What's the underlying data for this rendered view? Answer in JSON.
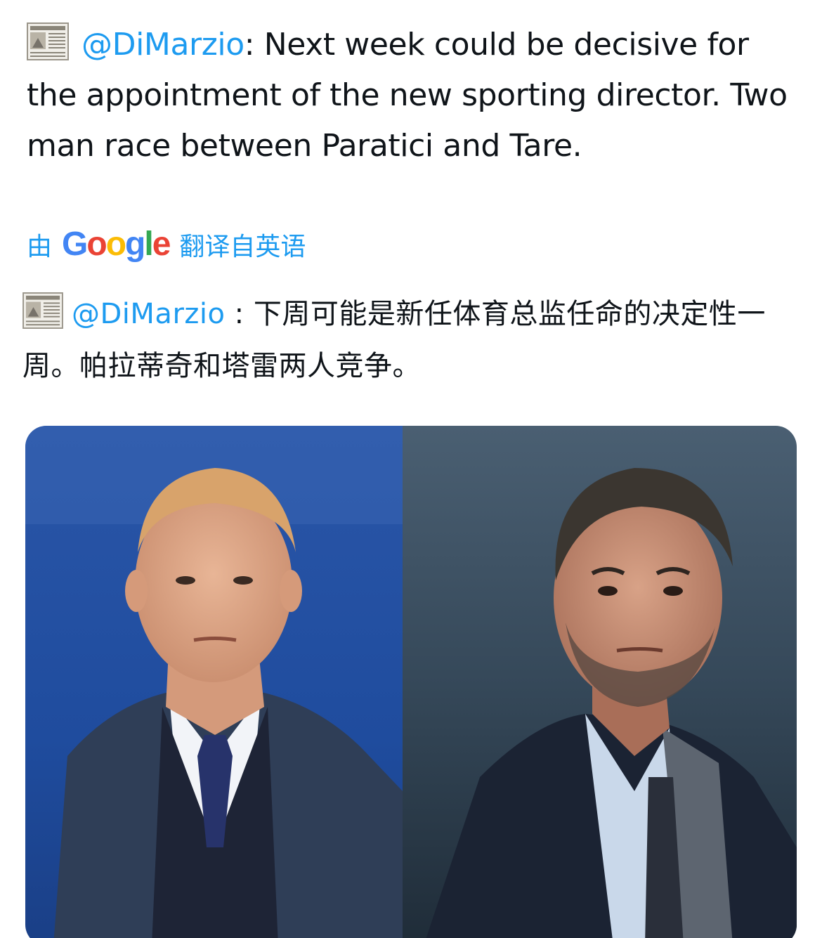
{
  "tweet": {
    "source_icon": "newspaper-icon",
    "mention": "@DiMarzio",
    "text": ": Next week could be decisive for the appointment of the new sporting director. Two man race between Paratici and Tare."
  },
  "translation_label": {
    "prefix": "由",
    "brand_letters": [
      "G",
      "o",
      "o",
      "g",
      "l",
      "e"
    ],
    "brand_colors": [
      "#4285f4",
      "#ea4335",
      "#fbbc05",
      "#4285f4",
      "#34a853",
      "#ea4335"
    ],
    "suffix": "翻译自英语"
  },
  "translation": {
    "source_icon": "newspaper-icon",
    "mention": "@DiMarzio",
    "text": " : 下周可能是新任体育总监任命的决定性一周。帕拉蒂奇和塔雷两人竞争。"
  },
  "colors": {
    "link": "#1d9bf0",
    "text": "#0f1419"
  },
  "media": {
    "photos": [
      "man-in-suit-photo",
      "man-in-suit-photo"
    ]
  }
}
